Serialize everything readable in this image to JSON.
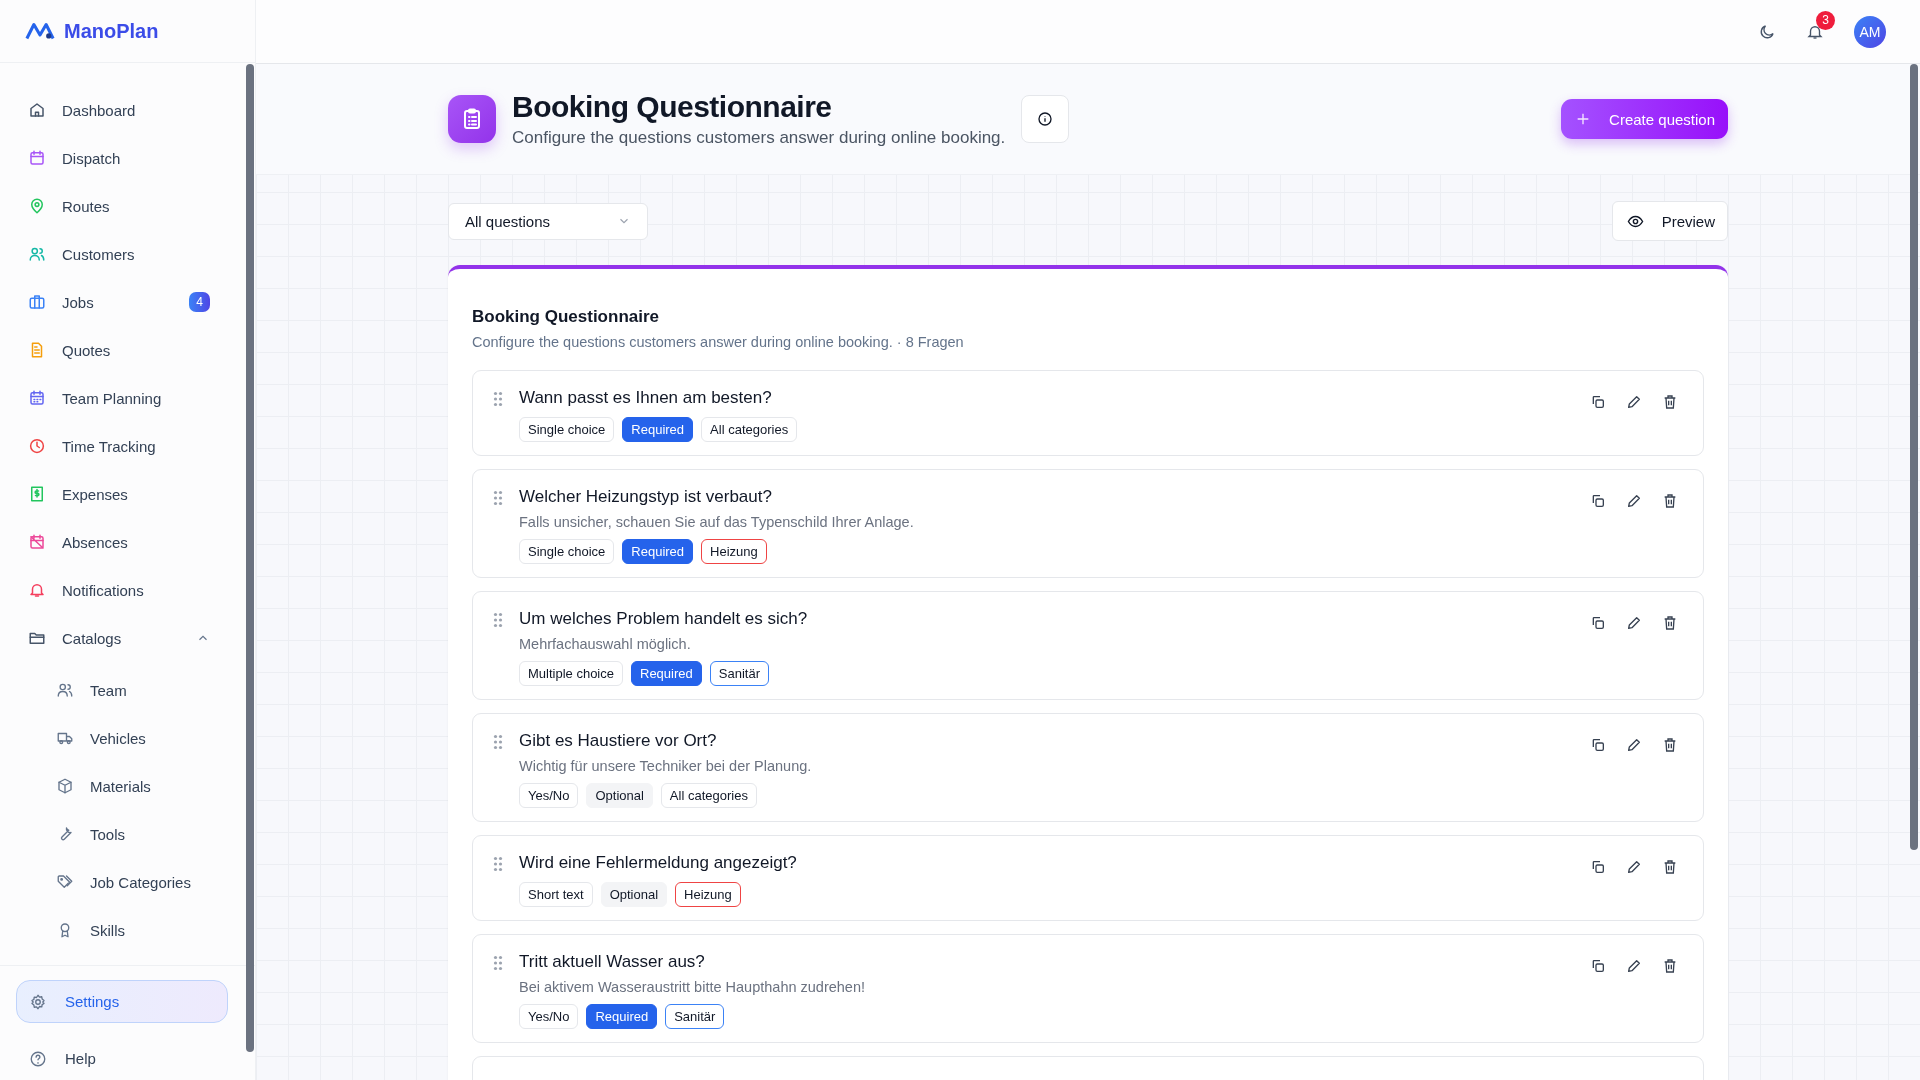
{
  "brand": {
    "name": "ManoPlan"
  },
  "sidebar": {
    "items": [
      {
        "label": "Dashboard",
        "selected": false
      },
      {
        "label": "Dispatch",
        "selected": false
      },
      {
        "label": "Routes",
        "selected": false
      },
      {
        "label": "Customers",
        "selected": false
      },
      {
        "label": "Jobs",
        "selected": false,
        "badge": "4"
      },
      {
        "label": "Quotes",
        "selected": false
      },
      {
        "label": "Team Planning",
        "selected": false
      },
      {
        "label": "Time Tracking",
        "selected": false
      },
      {
        "label": "Expenses",
        "selected": false
      },
      {
        "label": "Absences",
        "selected": false
      },
      {
        "label": "Notifications",
        "selected": false
      },
      {
        "label": "Catalogs",
        "selected": false,
        "expanded": true,
        "children": [
          {
            "label": "Team",
            "selected": false
          },
          {
            "label": "Vehicles",
            "selected": false
          },
          {
            "label": "Materials",
            "selected": false
          },
          {
            "label": "Tools",
            "selected": false
          },
          {
            "label": "Job Categories",
            "selected": false
          },
          {
            "label": "Skills",
            "selected": false
          }
        ]
      }
    ],
    "footer_items": [
      {
        "label": "Settings",
        "selected": true
      },
      {
        "label": "Help",
        "selected": false
      }
    ]
  },
  "topbar": {
    "notification_count": "3",
    "avatar": "AM"
  },
  "page": {
    "title": "Booking Questionnaire",
    "subtitle": "Configure the questions customers answer during online booking.",
    "create_button": "Create question",
    "filter": {
      "value": "All questions"
    },
    "preview_button": "Preview"
  },
  "questionnaire": {
    "title": "Booking Questionnaire",
    "summary": "Configure the questions customers answer during online booking. · 8 Fragen",
    "questions": [
      {
        "title": "Wann passt es Ihnen am besten?",
        "type": "Single choice",
        "requirement": "Required",
        "required": true,
        "category": {
          "label": "All categories",
          "color": "#e5e7eb"
        }
      },
      {
        "title": "Welcher Heizungstyp ist verbaut?",
        "description": "Falls unsicher, schauen Sie auf das Typenschild Ihrer Anlage.",
        "type": "Single choice",
        "requirement": "Required",
        "required": true,
        "category": {
          "label": "Heizung",
          "color": "#ef4444"
        }
      },
      {
        "title": "Um welches Problem handelt es sich?",
        "description": "Mehrfachauswahl möglich.",
        "type": "Multiple choice",
        "requirement": "Required",
        "required": true,
        "category": {
          "label": "Sanitär",
          "color": "#3b82f6"
        }
      },
      {
        "title": "Gibt es Haustiere vor Ort?",
        "description": "Wichtig für unsere Techniker bei der Planung.",
        "type": "Yes/No",
        "requirement": "Optional",
        "required": false,
        "category": {
          "label": "All categories",
          "color": "#e5e7eb"
        }
      },
      {
        "title": "Wird eine Fehlermeldung angezeigt?",
        "type": "Short text",
        "requirement": "Optional",
        "required": false,
        "category": {
          "label": "Heizung",
          "color": "#ef4444"
        }
      },
      {
        "title": "Tritt aktuell Wasser aus?",
        "description": "Bei aktivem Wasseraustritt bitte Haupthahn zudrehen!",
        "type": "Yes/No",
        "requirement": "Required",
        "required": true,
        "category": {
          "label": "Sanitär",
          "color": "#3b82f6"
        }
      }
    ]
  }
}
